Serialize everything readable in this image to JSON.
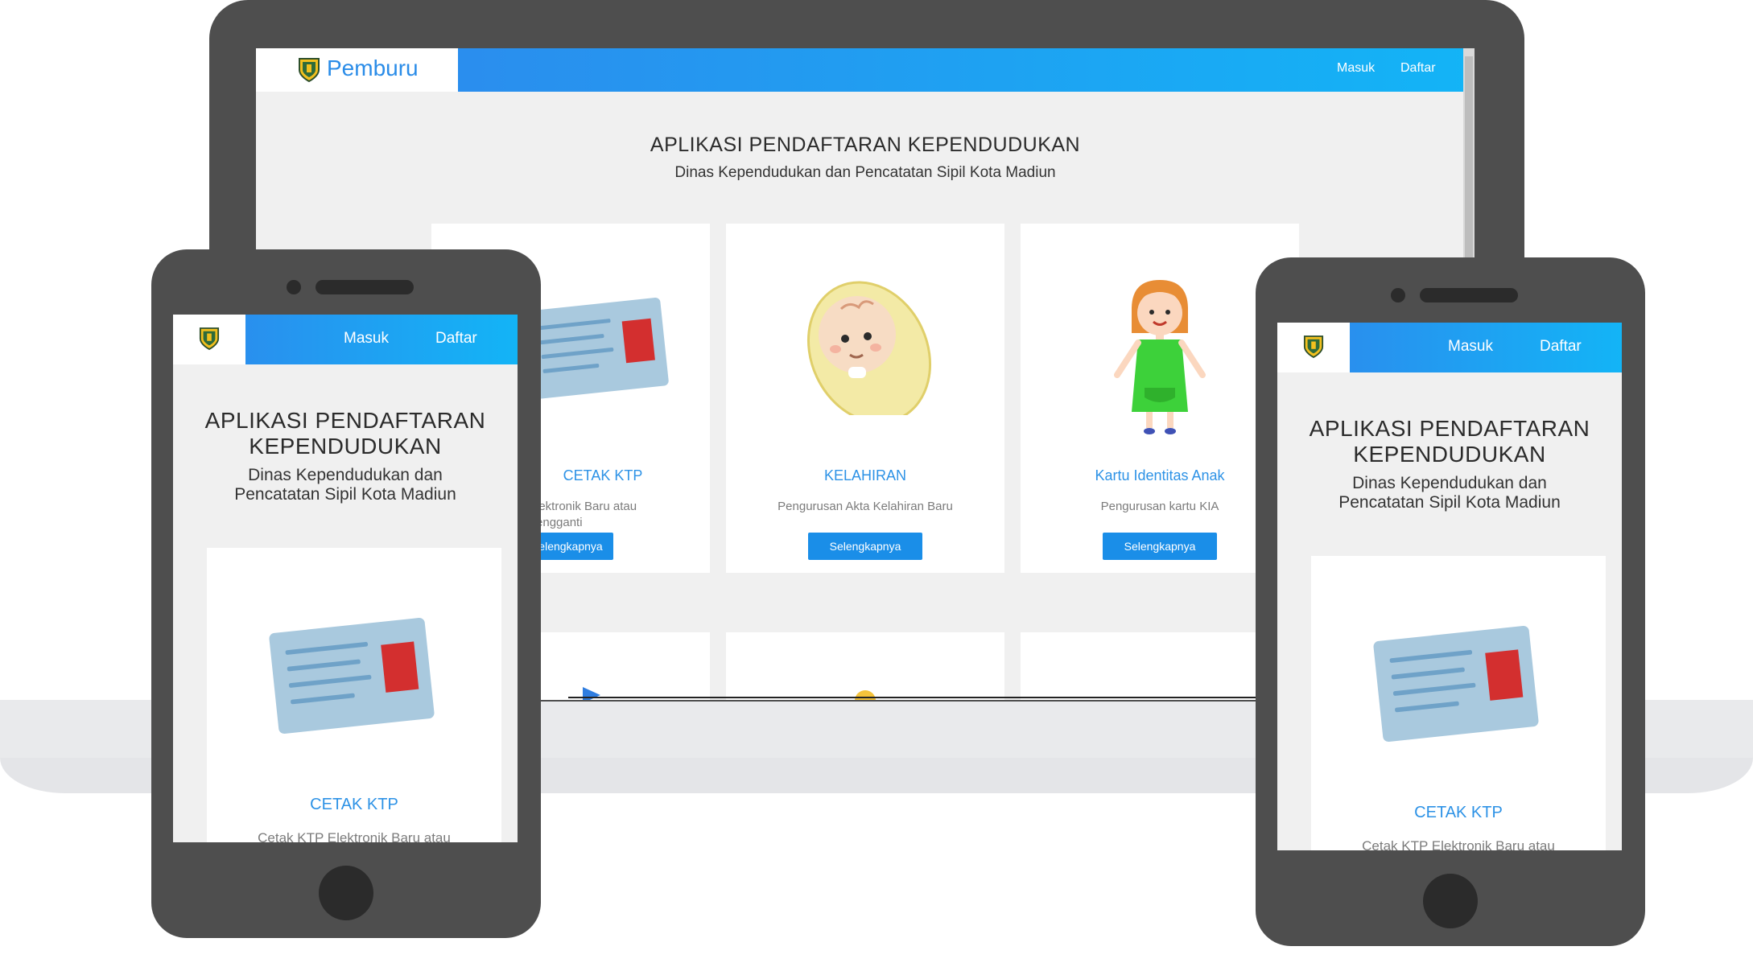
{
  "colors": {
    "accent": "#1a8ee8",
    "nav_gradient_start": "#2f86ec",
    "nav_gradient_end": "#13b4f6",
    "device_frame": "#4e4e4e",
    "screen_bg": "#f0f0f0"
  },
  "brand": {
    "name": "Pemburu",
    "logo_icon": "city-emblem-icon"
  },
  "nav": {
    "login": "Masuk",
    "register": "Daftar"
  },
  "hero": {
    "title": "APLIKASI PENDAFTARAN KEPENDUDUKAN",
    "subtitle": "Dinas Kependudukan dan Pencatatan Sipil Kota Madiun"
  },
  "cards": [
    {
      "icon": "id-card-icon",
      "title": "CETAK KTP",
      "desc": "Cetak KTP Elektronik Baru atau Pengganti",
      "button": "Selengkapnya"
    },
    {
      "icon": "baby-icon",
      "title": "KELAHIRAN",
      "desc": "Pengurusan Akta Kelahiran Baru",
      "button": "Selengkapnya"
    },
    {
      "icon": "child-icon",
      "title": "Kartu Identitas Anak",
      "desc": "Pengurusan kartu KIA",
      "button": "Selengkapnya"
    }
  ],
  "laptop_card1_visible": {
    "desc": "Elektronik Baru atau Pengganti",
    "button": "elengkapnya"
  },
  "phone_hero": {
    "title_line1": "APLIKASI PENDAFTARAN",
    "title_line2": "KEPENDUDUKAN",
    "sub_line1": "Dinas Kependudukan dan",
    "sub_line2": "Pencatatan Sipil Kota Madiun"
  },
  "phone_card": {
    "title": "CETAK KTP",
    "desc_partial": "Cetak KTP Elektronik Baru atau"
  }
}
